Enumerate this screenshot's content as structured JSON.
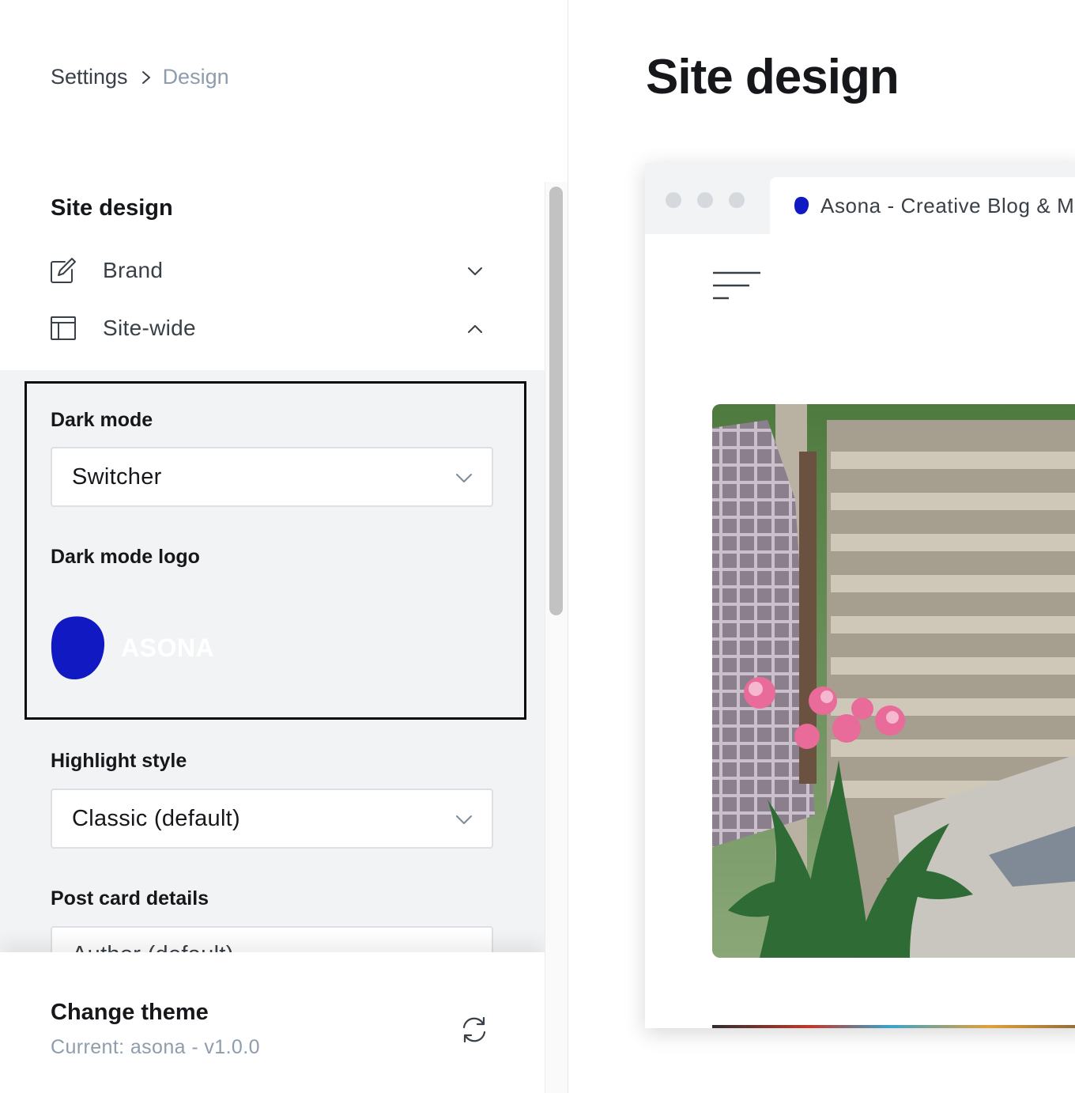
{
  "breadcrumb": {
    "parent": "Settings",
    "current": "Design"
  },
  "sidebar": {
    "section_title": "Site design",
    "nav": [
      {
        "label": "Brand",
        "icon": "pencil-square-icon",
        "state": "collapsed"
      },
      {
        "label": "Site-wide",
        "icon": "layout-icon",
        "state": "expanded"
      }
    ],
    "fields": {
      "dark_mode": {
        "label": "Dark mode",
        "value": "Switcher"
      },
      "dark_mode_logo": {
        "label": "Dark mode logo",
        "logo_text": "ASONA",
        "logo_color": "#1019c2"
      },
      "highlight_style": {
        "label": "Highlight style",
        "value": "Classic (default)"
      },
      "post_card_details": {
        "label": "Post card details",
        "value": "Author (default)"
      }
    },
    "footer": {
      "title": "Change theme",
      "subtitle": "Current: asona - v1.0.0",
      "icon": "refresh-icon"
    }
  },
  "preview": {
    "page_title": "Site design",
    "browser_tab_title": "Asona - Creative Blog & Magazine",
    "favicon_color": "#1019c2",
    "menu_icon": "hamburger-menu-icon"
  },
  "colors": {
    "accent": "#1019c2",
    "text": "#15171a",
    "muted": "#8e9cac",
    "panel": "#f1f3f5"
  }
}
